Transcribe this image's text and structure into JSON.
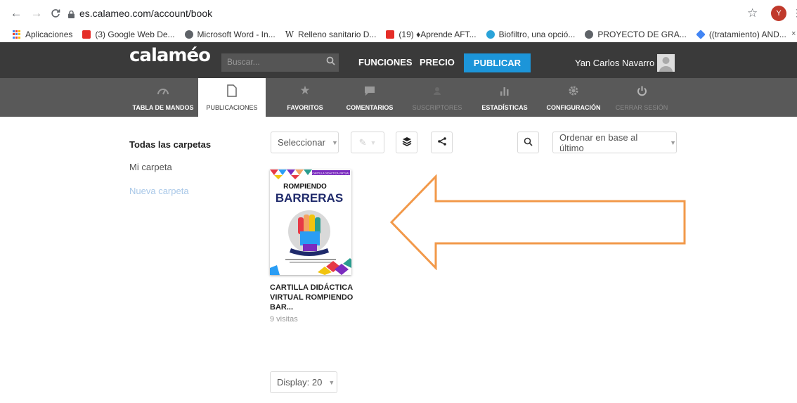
{
  "browser": {
    "url": "es.calameo.com/account/book",
    "profile_initial": "Y"
  },
  "bookmarks": [
    {
      "label": "Aplicaciones",
      "icon": "apps-grid-icon"
    },
    {
      "label": "(3) Google Web De...",
      "icon": "youtube-icon"
    },
    {
      "label": "Microsoft Word - In...",
      "icon": "globe-icon"
    },
    {
      "label": "Relleno sanitario D...",
      "icon": "wikipedia-icon"
    },
    {
      "label": "(19) ♦Aprende AFT...",
      "icon": "youtube-icon"
    },
    {
      "label": "Biofiltro, una opció...",
      "icon": "blue-circle-icon"
    },
    {
      "label": "PROYECTO DE GRA...",
      "icon": "globe-icon"
    },
    {
      "label": "((tratamiento) AND...",
      "icon": "diamond-icon"
    }
  ],
  "header": {
    "logo": "calaméo",
    "search_placeholder": "Buscar...",
    "links": [
      "FUNCIONES",
      "PRECIO"
    ],
    "publish_label": "PUBLICAR",
    "user_name": "Yan Carlos Navarro"
  },
  "subnav": [
    {
      "label": "TABLA DE MANDOS",
      "icon": "dashboard-gauge-icon",
      "state": "normal"
    },
    {
      "label": "PUBLICACIONES",
      "icon": "document-icon",
      "state": "active"
    },
    {
      "label": "FAVORITOS",
      "icon": "star-icon",
      "state": "normal"
    },
    {
      "label": "COMENTARIOS",
      "icon": "comment-icon",
      "state": "normal"
    },
    {
      "label": "SUSCRIPTORES",
      "icon": "subscribers-icon",
      "state": "disabled"
    },
    {
      "label": "ESTADÍSTICAS",
      "icon": "bar-chart-icon",
      "state": "normal"
    },
    {
      "label": "CONFIGURACIÓN",
      "icon": "gear-icon",
      "state": "normal"
    },
    {
      "label": "CERRAR SESIÓN",
      "icon": "power-icon",
      "state": "disabled"
    }
  ],
  "folders": {
    "all": "Todas las carpetas",
    "mine": "Mi carpeta",
    "new": "Nueva carpeta"
  },
  "toolbar": {
    "select_label": "Seleccionar",
    "sort_label": "Ordenar en base al último"
  },
  "publication": {
    "title": "CARTILLA DIDÁCTICA VIRTUAL ROMPIENDO BAR...",
    "views": "9 visitas",
    "cover_header": "CARTILLA DIDÁCTICA VIRTUAL",
    "cover_line1": "ROMPIENDO",
    "cover_line2": "BARRERAS"
  },
  "footer": {
    "display_label": "Display: 20"
  },
  "colors": {
    "topbar": "#3a3a3a",
    "subnav": "#595959",
    "publish": "#1c95d9",
    "annotation_arrow": "#f2994a"
  }
}
